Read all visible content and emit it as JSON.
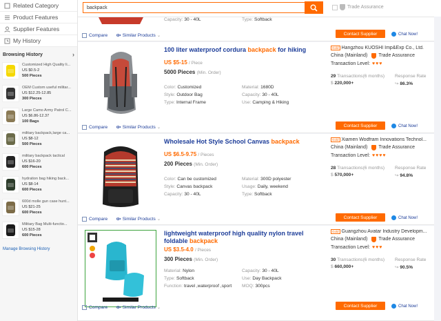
{
  "sidebar": {
    "nav": [
      {
        "label": "Related Category",
        "icon": "category-icon"
      },
      {
        "label": "Product Features",
        "icon": "features-icon"
      },
      {
        "label": "Supplier Features",
        "icon": "supplier-icon"
      },
      {
        "label": "My History",
        "icon": "history-icon"
      }
    ],
    "history_title": "Browsing History",
    "history": [
      {
        "title": "Customized High Quality li...",
        "price": "US $0.5-2",
        "moq": "500 Pieces",
        "color": "#f5d800"
      },
      {
        "title": "OEM Custom useful militar...",
        "price": "US $12.25-12.85",
        "moq": "300 Pieces",
        "color": "#333"
      },
      {
        "title": "Large Camo Army Patrol C...",
        "price": "US $6.86-12.37",
        "moq": "100 Bags",
        "color": "#8a7a55"
      },
      {
        "title": "military backpack,large ca...",
        "price": "US $8-12",
        "moq": "500 Pieces",
        "color": "#6b6b4a"
      },
      {
        "title": "military backpack tactical",
        "price": "US $16-20",
        "moq": "600 Pieces",
        "color": "#222"
      },
      {
        "title": "hydration bag hiking back...",
        "price": "US $8-14",
        "moq": "600 Pieces",
        "color": "#2c3b2a"
      },
      {
        "title": "600d molle gun case hunt...",
        "price": "US $21-25",
        "moq": "600 Pieces",
        "color": "#7d6c48"
      },
      {
        "title": "Military Bag Multi-functio...",
        "price": "US $15-28",
        "moq": "600 Pieces",
        "color": "#1a1a1a"
      }
    ],
    "manage": "Manage Browsing History"
  },
  "search": {
    "value": "backpack"
  },
  "trade_filter": "Trade Assurance",
  "top_partial": {
    "capacity": "30 - 40L",
    "type": "Softback",
    "compare": "Compare",
    "similar": "Similar Products",
    "contact": "Contact Supplier",
    "chat": "Chat Now!"
  },
  "products": [
    {
      "title_a": "100 liter waterproof cordura ",
      "title_kw": "backpack",
      "title_b": " for hiking",
      "price": "US $5-15",
      "price_unit": "/ Piece",
      "moq": "5000 Pieces",
      "moq_unit": "(Min. Order)",
      "attrs": [
        [
          "Color:",
          "Customized"
        ],
        [
          "Material:",
          "1680D"
        ],
        [
          "Style:",
          "Outdoor Bag"
        ],
        [
          "Capacity:",
          "30 - 40L"
        ],
        [
          "Type:",
          "Internal Frame"
        ],
        [
          "Use:",
          "Camping & Hiking"
        ]
      ],
      "supplier": "Hangzhou KUOSHI Imp&Exp Co., Ltd.",
      "country": "China (Mainland)",
      "trade": "Trade Assurance",
      "level": "Transaction Level:",
      "hearts": "♥♥♥",
      "transactions": "29",
      "tx_label": "Transactions(6 months)",
      "revenue": "220,000+",
      "rate_label": "Response Rate",
      "rate": "86.3%",
      "badge": "Gold",
      "compare": "Compare",
      "similar": "Similar Products",
      "contact": "Contact Supplier",
      "chat": "Chat Now!"
    },
    {
      "title_a": "Wholesale Hot Style School Canvas ",
      "title_kw": "backpack",
      "title_b": "",
      "price": "US $6.5-9.75",
      "price_unit": "/ Pieces",
      "moq": "200 Pieces",
      "moq_unit": "(Min. Order)",
      "attrs": [
        [
          "Color:",
          "Can be customized"
        ],
        [
          "Material:",
          "300D polyester"
        ],
        [
          "Style:",
          "Canvas backpack"
        ],
        [
          "Usage:",
          "Daily, weekend"
        ],
        [
          "Capacity:",
          "30 - 40L"
        ],
        [
          "Type:",
          "Softback"
        ]
      ],
      "supplier": "Xiamen Wodfram Innovations Technol...",
      "country": "China (Mainland)",
      "trade": "Trade Assurance",
      "level": "Transaction Level:",
      "hearts": "♥♥♥♥",
      "transactions": "28",
      "tx_label": "Transactions(6 months)",
      "revenue": "570,000+",
      "rate_label": "Response Rate",
      "rate": "94.8%",
      "badge": "Gold",
      "compare": "Compare",
      "similar": "Similar Products",
      "contact": "Contact Supplier",
      "chat": "Chat Now!"
    },
    {
      "title_a": "lightweight waterproof high quality nylon travel foldable ",
      "title_kw": "backpack",
      "title_b": "",
      "price": "US $3.5-4.0",
      "price_unit": "/ Pieces",
      "moq": "300 Pieces",
      "moq_unit": "(Min. Order)",
      "attrs": [
        [
          "Material:",
          "Nylon"
        ],
        [
          "Capacity:",
          "30 - 40L"
        ],
        [
          "Type:",
          "Softback"
        ],
        [
          "Use:",
          "Day Backpack"
        ],
        [
          "Function:",
          "travel ,waterproof ,sport"
        ],
        [
          "MOQ:",
          "300pcs"
        ]
      ],
      "supplier": "Guangzhou Avatar Industry Developm...",
      "country": "China (Mainland)",
      "trade": "Trade Assurance",
      "level": "Transaction Level:",
      "hearts": "♥♥♥",
      "transactions": "30",
      "tx_label": "Transactions(6 months)",
      "revenue": "660,000+",
      "rate_label": "Response Rate",
      "rate": "90.5%",
      "badge": "Gold",
      "compare": "Compare",
      "similar": "Similar Products",
      "contact": "Contact Supplier",
      "chat": "Chat Now!"
    }
  ],
  "colors": {
    "accent": "#ff6a00",
    "link": "#1d3d99"
  }
}
